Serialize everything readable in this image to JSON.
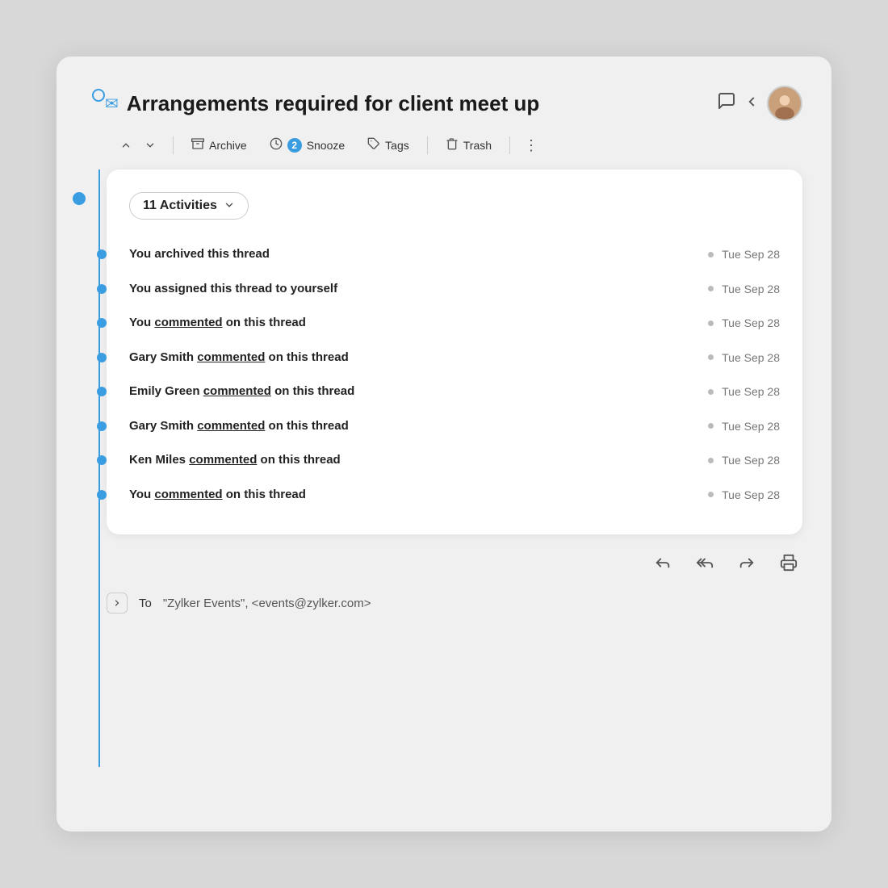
{
  "header": {
    "title": "Arrangements required for client meet up",
    "email_icon": "✉",
    "chat_icon": "💬",
    "collapse_icon": "‹"
  },
  "toolbar": {
    "up_arrow": "∧",
    "down_arrow": "∨",
    "archive_label": "Archive",
    "snooze_label": "Snooze",
    "tags_label": "Tags",
    "trash_label": "Trash",
    "more_icon": "⋮"
  },
  "activities": {
    "badge_label": "11 Activities",
    "items": [
      {
        "text_before": "You archived this thread",
        "underline": "",
        "text_after": "",
        "date": "Tue Sep 28"
      },
      {
        "text_before": "You assigned this thread to yourself",
        "underline": "",
        "text_after": "",
        "date": "Tue Sep 28"
      },
      {
        "text_before": "You ",
        "underline": "commented",
        "text_after": " on this thread",
        "date": "Tue Sep 28"
      },
      {
        "text_before": "Gary Smith ",
        "underline": "commented",
        "text_after": " on this thread",
        "date": "Tue Sep 28"
      },
      {
        "text_before": "Emily Green ",
        "underline": "commented",
        "text_after": " on this thread",
        "date": "Tue Sep 28"
      },
      {
        "text_before": "Gary Smith ",
        "underline": "commented",
        "text_after": " on this thread",
        "date": "Tue Sep 28"
      },
      {
        "text_before": "Ken Miles ",
        "underline": "commented",
        "text_after": " on this thread",
        "date": "Tue Sep 28"
      },
      {
        "text_before": "You ",
        "underline": "commented",
        "text_after": " on this thread",
        "date": "Tue Sep 28"
      }
    ]
  },
  "reply_buttons": [
    "↩",
    "↩↩",
    "↪",
    "🖨"
  ],
  "to_line": {
    "expand_icon": "›",
    "to_label": "To",
    "recipient": "\"Zylker Events\", <events@zylker.com>"
  }
}
